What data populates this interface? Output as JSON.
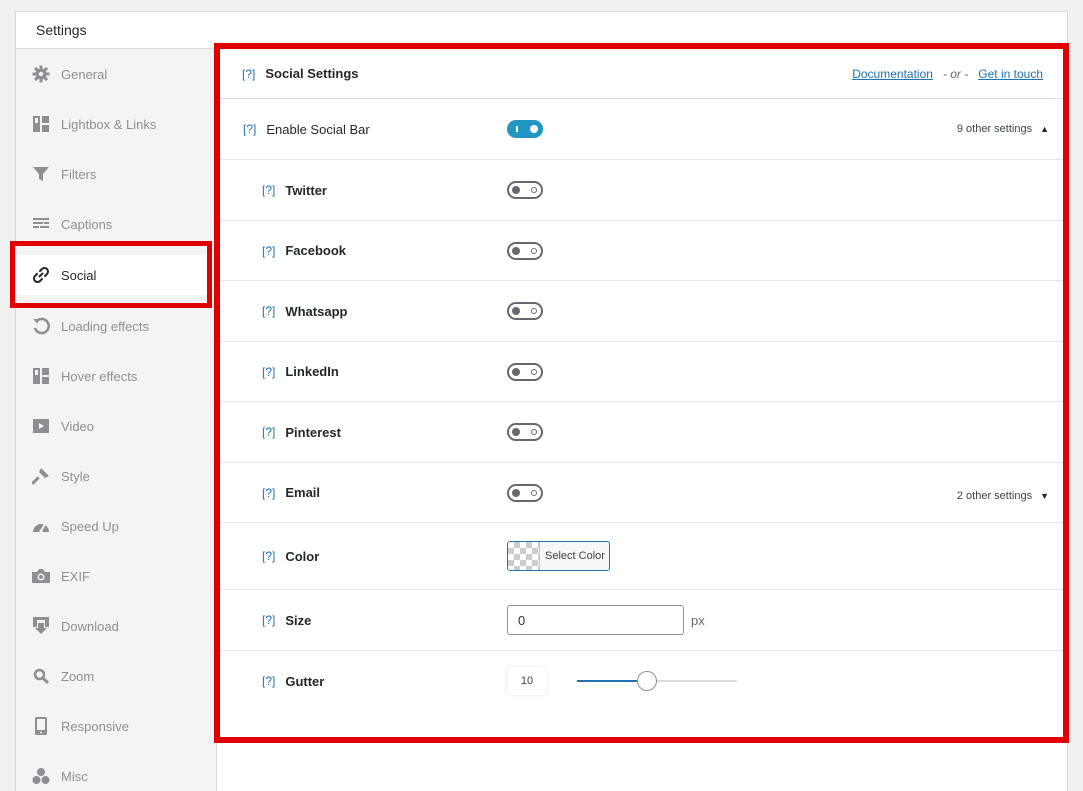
{
  "panel": {
    "title": "Settings"
  },
  "sidebar": {
    "items": [
      {
        "label": "General",
        "icon": "gear-icon",
        "active": false
      },
      {
        "label": "Lightbox & Links",
        "icon": "layout-icon",
        "active": false
      },
      {
        "label": "Filters",
        "icon": "filter-icon",
        "active": false
      },
      {
        "label": "Captions",
        "icon": "captions-icon",
        "active": false
      },
      {
        "label": "Social",
        "icon": "link-icon",
        "active": true
      },
      {
        "label": "Loading effects",
        "icon": "refresh-icon",
        "active": false
      },
      {
        "label": "Hover effects",
        "icon": "layout-icon",
        "active": false
      },
      {
        "label": "Video",
        "icon": "video-icon",
        "active": false
      },
      {
        "label": "Style",
        "icon": "brush-icon",
        "active": false
      },
      {
        "label": "Speed Up",
        "icon": "dashboard-icon",
        "active": false
      },
      {
        "label": "EXIF",
        "icon": "camera-icon",
        "active": false
      },
      {
        "label": "Download",
        "icon": "download-icon",
        "active": false
      },
      {
        "label": "Zoom",
        "icon": "search-icon",
        "active": false
      },
      {
        "label": "Responsive",
        "icon": "phone-icon",
        "active": false
      },
      {
        "label": "Misc",
        "icon": "groups-icon",
        "active": false
      }
    ]
  },
  "content": {
    "help": "[?]",
    "title": "Social Settings",
    "documentation": "Documentation",
    "or": "- or -",
    "get_in_touch": "Get in touch"
  },
  "rows": {
    "enable": {
      "help": "[?]",
      "label": "Enable Social Bar",
      "enabled": true,
      "extra": "9 other settings",
      "extra_arrow": "▲"
    },
    "twitter": {
      "help": "[?]",
      "label": "Twitter",
      "enabled": false
    },
    "facebook": {
      "help": "[?]",
      "label": "Facebook",
      "enabled": false
    },
    "whatsapp": {
      "help": "[?]",
      "label": "Whatsapp",
      "enabled": false
    },
    "linkedin": {
      "help": "[?]",
      "label": "LinkedIn",
      "enabled": false
    },
    "pinterest": {
      "help": "[?]",
      "label": "Pinterest",
      "enabled": false
    },
    "email": {
      "help": "[?]",
      "label": "Email",
      "enabled": false,
      "extra": "2 other settings",
      "extra_arrow": "▼"
    },
    "color": {
      "help": "[?]",
      "label": "Color",
      "button": "Select Color"
    },
    "size": {
      "help": "[?]",
      "label": "Size",
      "value": "0",
      "unit": "px"
    },
    "gutter": {
      "help": "[?]",
      "label": "Gutter",
      "value": "10",
      "level": 0.44
    }
  },
  "colors": {
    "accent": "#2271b1",
    "toggle_on": "#2196c3",
    "highlight": "#e00000"
  }
}
